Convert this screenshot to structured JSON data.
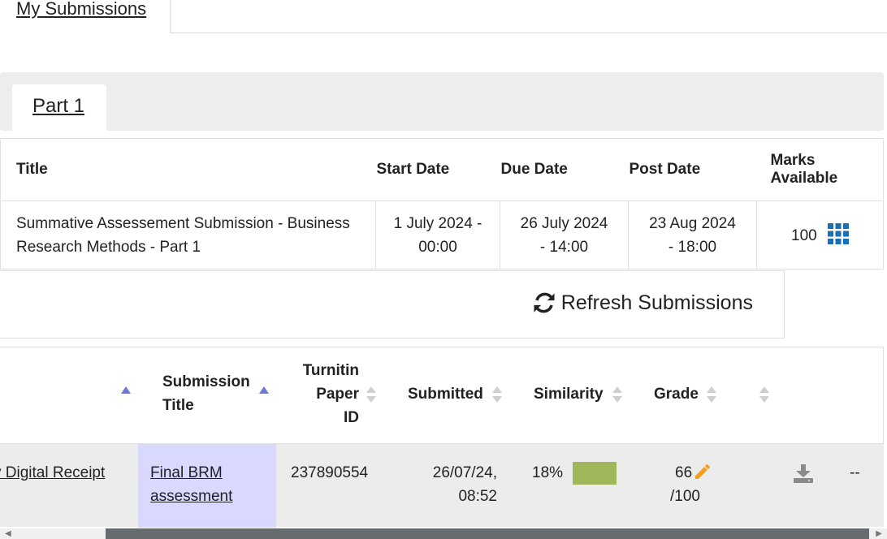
{
  "top_tab": {
    "label": "My Submissions"
  },
  "part_tab": {
    "label": "Part 1"
  },
  "assignment_table": {
    "headers": {
      "title": "Title",
      "start_date": "Start Date",
      "due_date": "Due Date",
      "post_date": "Post Date",
      "marks_line1": "Marks",
      "marks_line2": "Available"
    },
    "row": {
      "title_line1": "Summative Assessement Submission - Business",
      "title_line2": "Research Methods - Part 1",
      "start_line1": "1 July 2024 -",
      "start_line2": "00:00",
      "due_line1": "26 July 2024",
      "due_line2": "- 14:00",
      "post_line1": "23 Aug 2024",
      "post_line2": "- 18:00",
      "marks": "100",
      "marks_icon": "grid-icon"
    }
  },
  "refresh": {
    "label": "Refresh Submissions",
    "icon": "refresh-icon"
  },
  "submissions_table": {
    "headers": {
      "submission_title_line1": "Submission",
      "submission_title_line2": "Title",
      "paper_id_line1": "Turnitin",
      "paper_id_line2": "Paper",
      "paper_id_line3": "ID",
      "submitted": "Submitted",
      "similarity": "Similarity",
      "grade": "Grade"
    },
    "row": {
      "receipt_link": "v Digital Receipt",
      "submission_title_line1": "Final BRM",
      "submission_title_line2": "assessment",
      "paper_id": "237890554",
      "submitted_line1": "26/07/24,",
      "submitted_line2": "08:52",
      "similarity": "18%",
      "grade_value": "66",
      "grade_total": "/100",
      "last_col": "--"
    }
  },
  "colors": {
    "similarity_bar": "#9fb659",
    "selected_cell": "#d9d9ff",
    "grid_icon": "#1a6fb5",
    "pencil_icon": "#f0a020"
  }
}
